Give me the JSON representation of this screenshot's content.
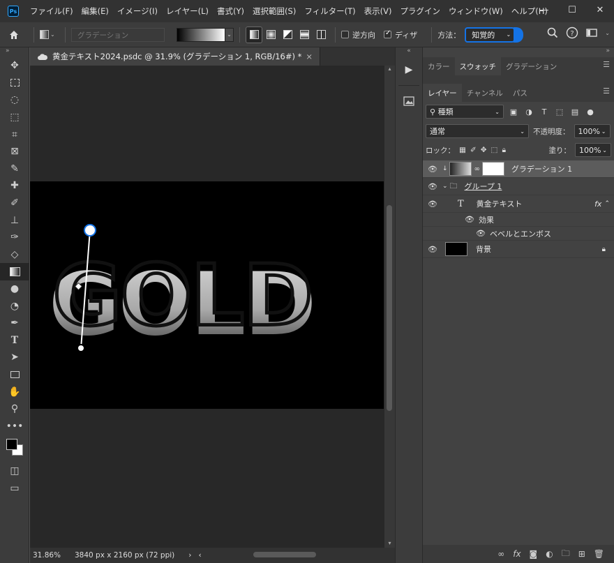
{
  "app": {
    "logo": "Ps",
    "menu": [
      "ファイル(F)",
      "編集(E)",
      "イメージ(I)",
      "レイヤー(L)",
      "書式(Y)",
      "選択範囲(S)",
      "フィルター(T)",
      "表示(V)",
      "プラグイン",
      "ウィンドウ(W)",
      "ヘルプ(H)"
    ],
    "window_controls": {
      "minimize": "—",
      "maximize": "☐",
      "close": "✕"
    }
  },
  "options": {
    "home_icon": "home-icon",
    "preset_placeholder": "グラデーション",
    "types": [
      "linear",
      "radial",
      "angle",
      "reflected",
      "diamond"
    ],
    "reverse_label": "逆方向",
    "reverse_checked": false,
    "dither_label": "ディザ",
    "dither_checked": true,
    "method_label": "方法：",
    "method_value": "知覚的",
    "accent_color": "#1473e6"
  },
  "document": {
    "tab_title": "黄金テキスト2024.psdc @ 31.9% (グラデーション 1, RGB/16#) *",
    "tab_close": "×",
    "canvas_text": "GOLD",
    "status_zoom": "31.86%",
    "status_info": "3840 px x 2160 px (72 ppi)",
    "status_arrow": "›",
    "status_left": "‹"
  },
  "toolbar": {
    "tools": [
      "move",
      "marquee",
      "lasso",
      "object-select",
      "crop",
      "frame",
      "eyedropper",
      "healing",
      "brush",
      "stamp",
      "history-brush",
      "eraser",
      "gradient",
      "blur",
      "dodge",
      "pen",
      "type",
      "path-select",
      "rectangle",
      "hand",
      "zoom",
      "more"
    ],
    "active_tool": "gradient",
    "foreground_color": "#000000",
    "background_color": "#ffffff"
  },
  "panels": {
    "top_tabs": [
      "カラー",
      "スウォッチ",
      "グラデーション"
    ],
    "top_active": "スウォッチ",
    "layer_tabs": [
      "レイヤー",
      "チャンネル",
      "パス"
    ],
    "layer_active": "レイヤー",
    "filter_kind": "種類",
    "blend_mode": "通常",
    "opacity_label": "不透明度：",
    "opacity_value": "100%",
    "lock_label": "ロック：",
    "fill_label": "塗り：",
    "fill_value": "100%",
    "layers": [
      {
        "name": "グラデーション 1",
        "kind": "gradient-fill",
        "selected": true
      },
      {
        "name": "グループ 1",
        "kind": "group"
      },
      {
        "name": "黄金テキスト",
        "kind": "text",
        "fx": "fx"
      },
      {
        "name": "効果",
        "kind": "effects"
      },
      {
        "name": "ベベルとエンボス",
        "kind": "effect"
      },
      {
        "name": "背景",
        "kind": "background"
      }
    ]
  }
}
